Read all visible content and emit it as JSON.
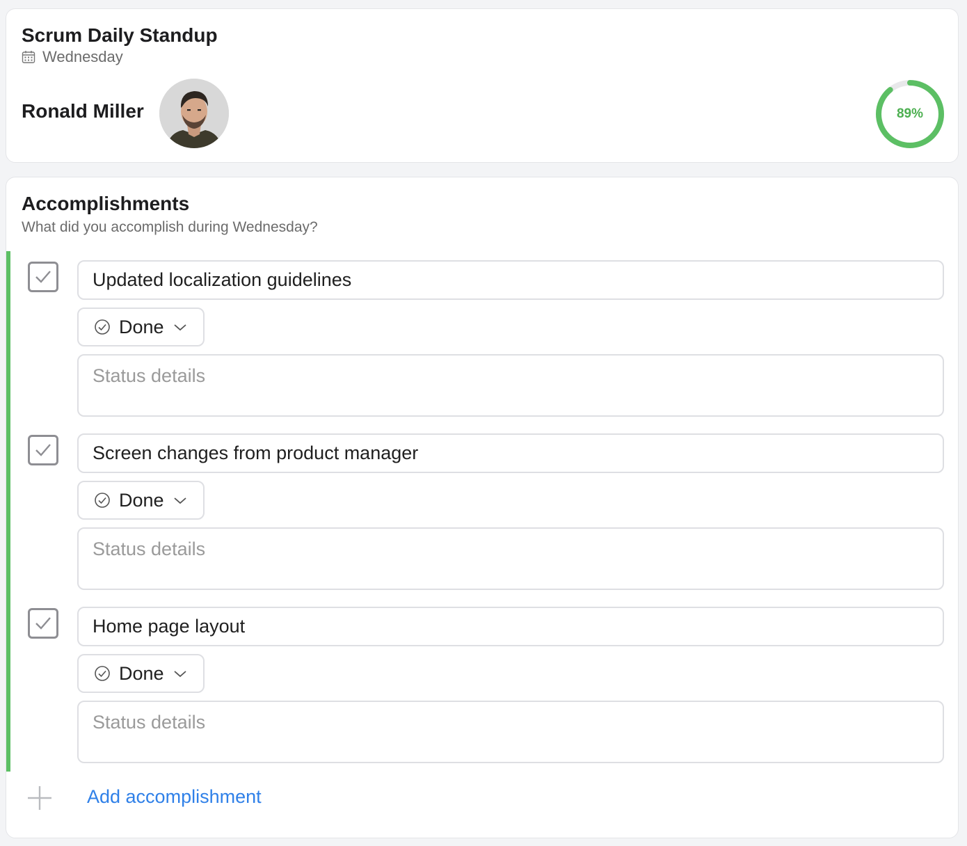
{
  "header": {
    "title": "Scrum Daily Standup",
    "day": "Wednesday",
    "user_name": "Ronald Miller",
    "progress_percent": 89,
    "progress_label": "89%",
    "accent_color": "#4caf50"
  },
  "accomplishments": {
    "title": "Accomplishments",
    "subtitle": "What did you accomplish during Wednesday?",
    "items": [
      {
        "task": "Updated localization guidelines",
        "checked": true,
        "status": "Done",
        "details_placeholder": "Status details"
      },
      {
        "task": "Screen changes from product manager",
        "checked": true,
        "status": "Done",
        "details_placeholder": "Status details"
      },
      {
        "task": "Home page layout",
        "checked": true,
        "status": "Done",
        "details_placeholder": "Status details"
      }
    ],
    "add_label": "Add accomplishment",
    "link_color": "#2f80e8"
  }
}
